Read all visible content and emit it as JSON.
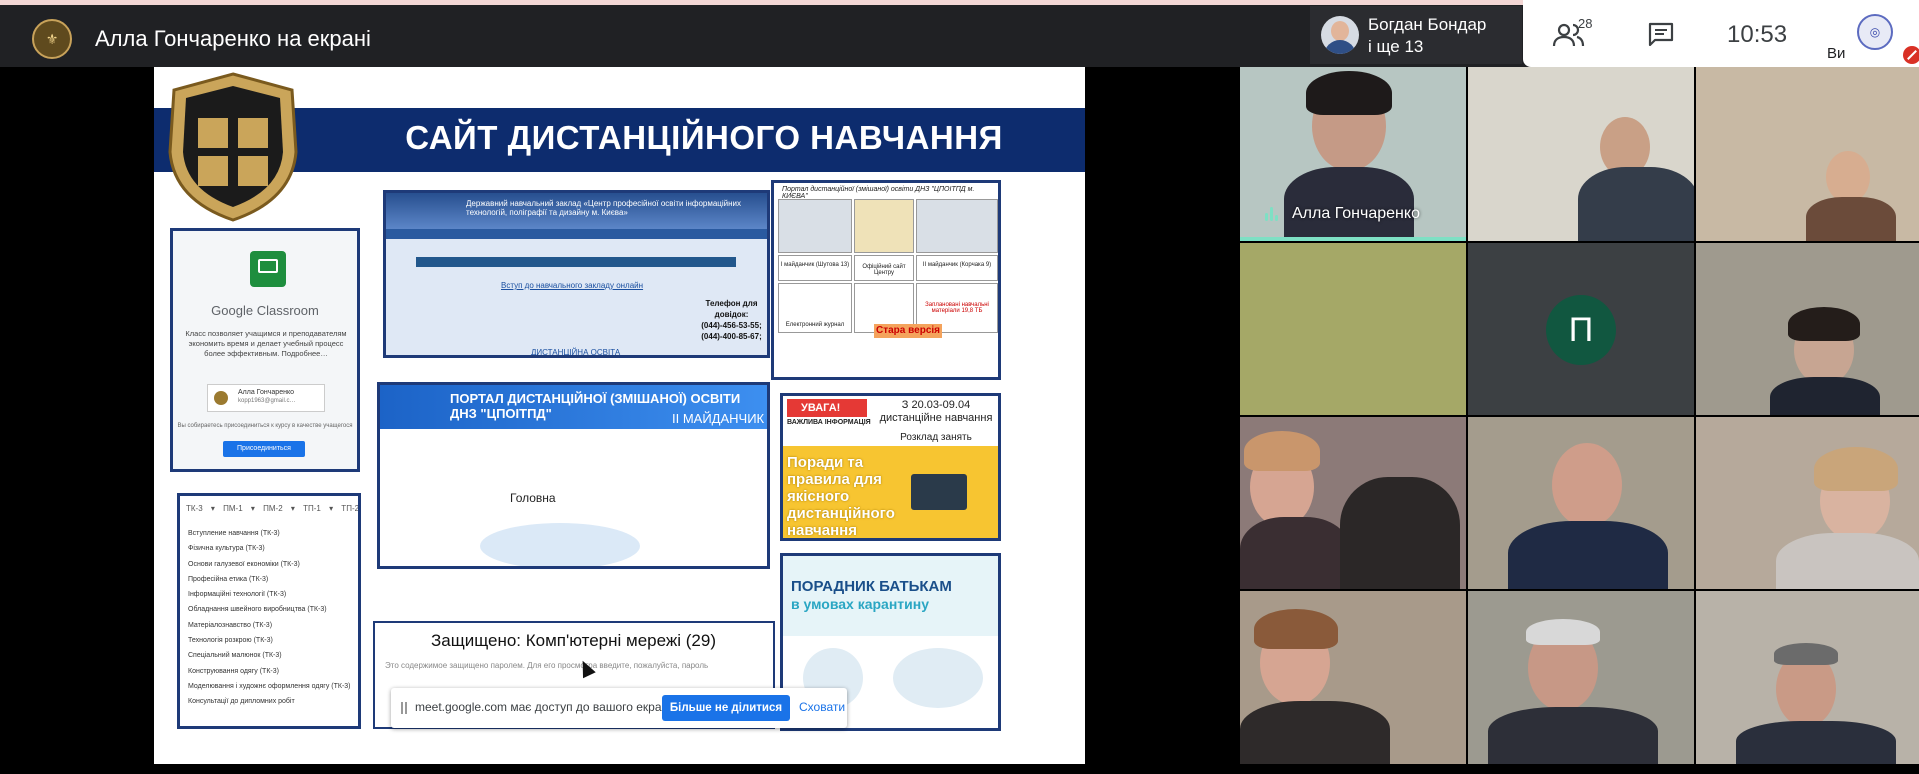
{
  "meeting": {
    "presenting_title": "Алла Гончаренко на екрані",
    "host_name": "Богдан Бондар",
    "host_more": "і ще 13",
    "participant_count": "28",
    "time": "10:53",
    "self_label": "Ви"
  },
  "icons": {
    "people": "people-icon",
    "chat": "chat-icon",
    "mic": "mic-off-icon"
  },
  "slide": {
    "title": "САЙТ ДИСТАНЦІЙНОГО НАВЧАННЯ",
    "classroom": {
      "name": "Google Classroom",
      "description": "Класс позволяет учащимся и преподавателям экономить время и делает учебный процесс более эффективным. Подробнее…",
      "account_name": "Алла Гончаренко",
      "account_email": "kopp1963@gmail.c…",
      "note": "Вы собираетесь присоединиться к курсу в качестве учащегося",
      "join_button": "Присоединиться"
    },
    "tk_tabs": "ТК-3 ▾  ПМ-1 ▾  ПМ-2 ▾  ТП-1 ▾  ТП-2",
    "tk_items": [
      "Вступление навчання (ТК-3)",
      "Фізична культура (ТК-3)",
      "Основи галузевої економіки (ТК-3)",
      "Професійна етика (ТК-3)",
      "Інформаційні технології (ТК-3)",
      "Обладнання швейного виробництва (ТК-3)",
      "Матеріалознавство (ТК-3)",
      "Технологія розкрою (ТК-3)",
      "Спеціальний малюнок (ТК-3)",
      "Конструювання одягу (ТК-3)",
      "Моделювання і художнє оформлення одягу (ТК-3)",
      "Консультації до дипломних робіт"
    ],
    "site1": {
      "header": "Державний навчальний заклад «Центр професійної освіти інформаційних технологій, поліграфії та дизайну м. Києва»",
      "link": "Вступ до навчального закладу онлайн",
      "phone_label": "Телефон для довідок:",
      "phones": "(044)-456-53-55; (044)-400-85-67;",
      "dist_link": "ДИСТАНЦІЙНА ОСВІТА"
    },
    "portal1": {
      "title": "Портал дистанційної (змішаної) освіти ДНЗ \"ЦПОІТПД м. КИЄВА\"",
      "site_a": "I майданчик (Шутова 13)",
      "official": "Офіційний сайт Центру",
      "site_b": "II майданчик (Корчака 9)",
      "journal": "Електронний журнал",
      "old_version": "Стара версія",
      "planned": "Заплановані навчальні матеріали 19,8 ТБ"
    },
    "portal2": {
      "title": "ПОРТАЛ ДИСТАНЦІЙНОЇ (ЗМІШАНОЇ) ОСВІТИ ДНЗ \"ЦПОІТПД\"",
      "subtitle": "II МАЙДАНЧИК",
      "home": "Головна"
    },
    "schedule": {
      "warning": "УВАГА!",
      "info": "ВАЖЛИВА ІНФОРМАЦІЯ",
      "date": "З 20.03-09.04 дистанційне навчання",
      "timetable": "Розклад занять",
      "tips": "Поради та правила для якісного дистанційного навчання"
    },
    "advice": {
      "title1": "ПОРАДНИК БАТЬКАМ",
      "title2": "в умовах карантину"
    },
    "protected": {
      "heading": "Защищено: Комп'ютерні мережі (29)",
      "text": "Это содержимое защищено паролем. Для его просмотра введите, пожалуйста, пароль"
    }
  },
  "share_bar": {
    "message": "meet.google.com має доступ до вашого екрана.",
    "stop_button": "Більше не ділитися",
    "hide_link": "Сховати"
  },
  "tiles": [
    {
      "label": "Алла Гончаренко"
    },
    {
      "label": ""
    },
    {
      "label": ""
    },
    {
      "label": ""
    },
    {
      "initial": "П"
    }
  ],
  "colors": {
    "accent": "#1a73e8",
    "speaking": "#7ee0c4",
    "avatar_green": "#115740",
    "slide_banner": "#0d2c6e"
  }
}
